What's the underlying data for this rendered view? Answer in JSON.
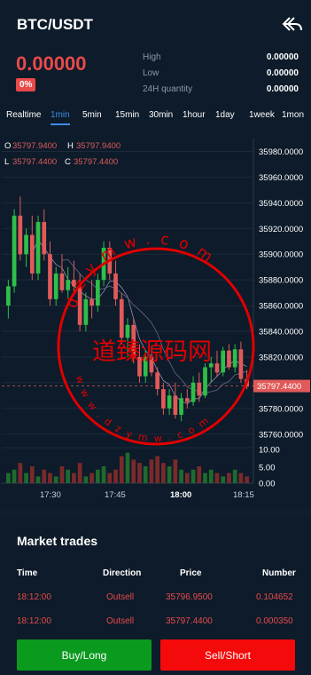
{
  "header": {
    "title": "BTC/USDT",
    "price": "0.00000",
    "change_pct": "0%",
    "stats": [
      {
        "label": "High",
        "value": "0.00000"
      },
      {
        "label": "Low",
        "value": "0.00000"
      },
      {
        "label": "24H quantity",
        "value": "0.00000"
      }
    ]
  },
  "tabs": [
    "Realtime",
    "1min",
    "5min",
    "15min",
    "30min",
    "1hour",
    "1day",
    "1week",
    "1mon"
  ],
  "active_tab": "1min",
  "legend": {
    "o_label": "O",
    "o_value": "35797.9400",
    "h_label": "H",
    "h_value": "35797.9400",
    "l_label": "L",
    "l_value": "35797.4400",
    "c_label": "C",
    "c_value": "35797.4400"
  },
  "price_axis": [
    "35980.0000",
    "35960.0000",
    "35940.0000",
    "35920.0000",
    "35900.0000",
    "35880.0000",
    "35860.0000",
    "35840.0000",
    "35820.0000",
    "35797.4400",
    "35780.0000",
    "35760.0000"
  ],
  "volume_axis": [
    "10.00",
    "5.00",
    "0.00"
  ],
  "time_axis": [
    "17:30",
    "17:45",
    "18:00",
    "18:15"
  ],
  "watermark": {
    "chinese": "道臻源码网",
    "letters_top": "dzymw.com",
    "letters_bottom": "www.dzymw.com"
  },
  "chart_data": {
    "type": "candlestick",
    "x_labels": [
      "17:30",
      "17:45",
      "18:00",
      "18:15"
    ],
    "y_range": [
      35755,
      35990
    ],
    "last_price": 35797.44,
    "candles": [
      [
        35860,
        35880,
        35850,
        35875
      ],
      [
        35875,
        35935,
        35870,
        35930
      ],
      [
        35930,
        35945,
        35895,
        35900
      ],
      [
        35900,
        35920,
        35890,
        35915
      ],
      [
        35915,
        35930,
        35880,
        35885
      ],
      [
        35885,
        35930,
        35880,
        35925
      ],
      [
        35925,
        35935,
        35895,
        35900
      ],
      [
        35900,
        35910,
        35860,
        35865
      ],
      [
        35865,
        35890,
        35860,
        35885
      ],
      [
        35885,
        35900,
        35870,
        35872
      ],
      [
        35872,
        35890,
        35865,
        35880
      ],
      [
        35880,
        35895,
        35870,
        35875
      ],
      [
        35875,
        35885,
        35840,
        35845
      ],
      [
        35845,
        35870,
        35840,
        35865
      ],
      [
        35865,
        35880,
        35850,
        35860
      ],
      [
        35860,
        35885,
        35855,
        35880
      ],
      [
        35880,
        35910,
        35875,
        35905
      ],
      [
        35905,
        35910,
        35880,
        35885
      ],
      [
        35885,
        35895,
        35860,
        35865
      ],
      [
        35865,
        35870,
        35830,
        35835
      ],
      [
        35835,
        35850,
        35820,
        35845
      ],
      [
        35845,
        35850,
        35815,
        35820
      ],
      [
        35820,
        35830,
        35800,
        35805
      ],
      [
        35805,
        35825,
        35800,
        35820
      ],
      [
        35820,
        35828,
        35805,
        35808
      ],
      [
        35808,
        35812,
        35790,
        35795
      ],
      [
        35795,
        35800,
        35775,
        35780
      ],
      [
        35780,
        35795,
        35775,
        35790
      ],
      [
        35790,
        35800,
        35772,
        35775
      ],
      [
        35775,
        35792,
        35770,
        35788
      ],
      [
        35788,
        35795,
        35780,
        35785
      ],
      [
        35785,
        35805,
        35782,
        35800
      ],
      [
        35800,
        35808,
        35785,
        35790
      ],
      [
        35790,
        35815,
        35788,
        35812
      ],
      [
        35812,
        35820,
        35800,
        35815
      ],
      [
        35815,
        35825,
        35805,
        35808
      ],
      [
        35808,
        35828,
        35805,
        35825
      ],
      [
        35825,
        35830,
        35810,
        35812
      ],
      [
        35812,
        35830,
        35808,
        35826
      ],
      [
        35826,
        35832,
        35800,
        35803
      ],
      [
        35803,
        35810,
        35795,
        35797
      ]
    ],
    "volumes": [
      3,
      4,
      6,
      3,
      5,
      2,
      4,
      3,
      2,
      5,
      4,
      3,
      6,
      2,
      3,
      4,
      5,
      3,
      4,
      8,
      9,
      7,
      6,
      5,
      7,
      8,
      6,
      5,
      7,
      4,
      3,
      4,
      5,
      3,
      4,
      3,
      2,
      3,
      4,
      3,
      2
    ]
  },
  "trades": {
    "title": "Market trades",
    "headers": [
      "Time",
      "Direction",
      "Price",
      "Number"
    ],
    "rows": [
      [
        "18:12:00",
        "Outsell",
        "35796.9500",
        "0.104652"
      ],
      [
        "18:12:00",
        "Outsell",
        "35797.4400",
        "0.000350"
      ]
    ]
  },
  "actions": {
    "buy": "Buy/Long",
    "sell": "Sell/Short"
  },
  "colors": {
    "up": "#2fbe4a",
    "down": "#e05a5a",
    "accent": "#3a8ee6",
    "buy": "#0a9a1e",
    "sell": "#f40a0a"
  }
}
